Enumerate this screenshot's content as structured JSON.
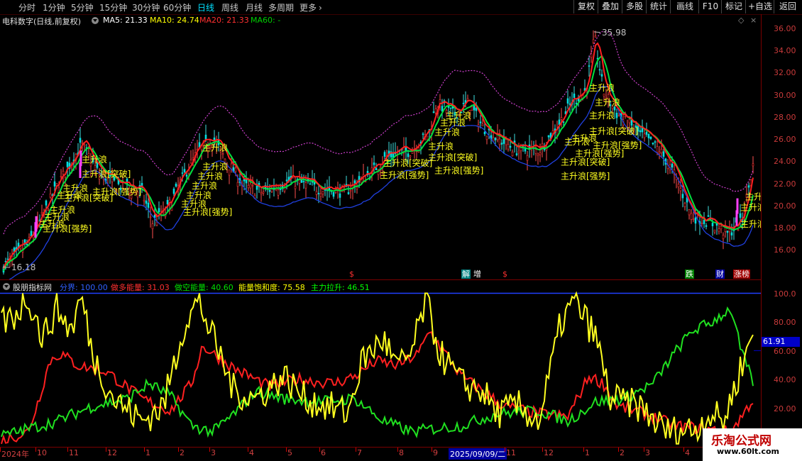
{
  "periods": [
    {
      "label": "分时",
      "active": false
    },
    {
      "label": "1分钟",
      "active": false
    },
    {
      "label": "5分钟",
      "active": false
    },
    {
      "label": "15分钟",
      "active": false
    },
    {
      "label": "30分钟",
      "active": false
    },
    {
      "label": "60分钟",
      "active": false
    },
    {
      "label": "日线",
      "active": true
    },
    {
      "label": "周线",
      "active": false
    },
    {
      "label": "月线",
      "active": false
    },
    {
      "label": "多周期",
      "active": false
    },
    {
      "label": "更多",
      "active": false
    }
  ],
  "toolbar": [
    "复权",
    "叠加",
    "多股",
    "统计",
    "画线",
    "F10",
    "标记",
    "+自选",
    "返回"
  ],
  "main": {
    "stock_name": "电科数字(日线,前复权)",
    "ma": [
      {
        "label": "MA5: 21.33",
        "color": "#ffffff"
      },
      {
        "label": "MA10: 24.74",
        "color": "#ffff00"
      },
      {
        "label": "MA20: 21.33",
        "color": "#ff3030"
      },
      {
        "label": "MA60: -",
        "color": "#00d000"
      }
    ],
    "high_label": "35.98",
    "low_label": "16.18",
    "yticks": [
      "36.00",
      "34.00",
      "32.00",
      "30.00",
      "28.00",
      "26.00",
      "24.00",
      "22.00",
      "20.00",
      "18.00",
      "16.00"
    ],
    "annotations": [
      "主升浪",
      "主升浪[突破]",
      "主升浪[强势]"
    ],
    "events": [
      {
        "label": "$",
        "color": "#ff3030",
        "bg": ""
      },
      {
        "label": "解",
        "color": "#ffffff",
        "bg": "#008080"
      },
      {
        "label": "增",
        "color": "#ffffff",
        "bg": ""
      },
      {
        "label": "$",
        "color": "#ff3030",
        "bg": ""
      },
      {
        "label": "跌",
        "color": "#ffffff",
        "bg": "#008000"
      },
      {
        "label": "财",
        "color": "#ffffff",
        "bg": "#0000a0"
      },
      {
        "label": "涨榜",
        "color": "#ffffff",
        "bg": "#a00000"
      }
    ]
  },
  "indicator": {
    "name": "股朋指标网",
    "values": [
      {
        "label": "分界: 100.00",
        "color": "#3060ff"
      },
      {
        "label": "做多能量: 31.03",
        "color": "#ff3030"
      },
      {
        "label": "做空能量: 40.60",
        "color": "#00e000"
      },
      {
        "label": "能量饱和度: 75.58",
        "color": "#ffff00"
      },
      {
        "label": "主力拉升: 46.51",
        "color": "#00ff00"
      }
    ],
    "yticks": [
      "100.0",
      "80.00",
      "60.00",
      "40.00",
      "20.00"
    ],
    "current_value": "61.91"
  },
  "dates": [
    "2024年",
    "10",
    "11",
    "12",
    "1",
    "2",
    "3",
    "4",
    "5",
    "6",
    "7",
    "8",
    "9",
    "2025/09/09/二",
    "11",
    "12",
    "1",
    "2",
    "3",
    "4"
  ],
  "watermark": {
    "title": "乐淘公式网",
    "url": "www.60lt.com"
  }
}
